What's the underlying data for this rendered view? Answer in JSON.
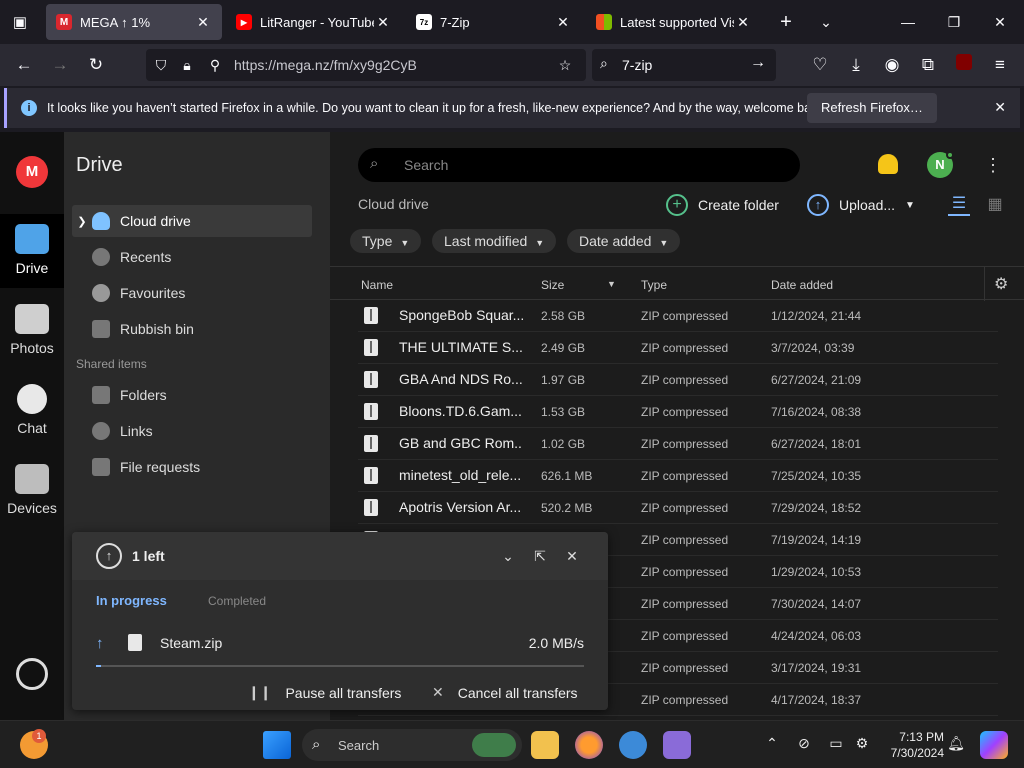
{
  "browser": {
    "tabs": [
      {
        "label": "MEGA ↑ 1%",
        "active": true,
        "favicon_color": "#d9272e",
        "favicon_text": "M"
      },
      {
        "label": "LitRanger - YouTube",
        "active": false,
        "favicon_color": "#ff0000",
        "favicon_text": "▶"
      },
      {
        "label": "7-Zip",
        "active": false,
        "favicon_color": "#ffffff",
        "favicon_text": "7z"
      },
      {
        "label": "Latest supported Visual",
        "active": false,
        "favicon_color": "#f25022",
        "favicon_text": ""
      }
    ],
    "url": "https://mega.nz/fm/xy9g2CyB",
    "search_value": "7-zip",
    "notification": {
      "message": "It looks like you haven’t started Firefox in a while. Do you want to clean it up for a fresh, like-new experience? And by the way, welcome back!",
      "button": "Refresh Firefox…"
    }
  },
  "rail": {
    "logo": "M",
    "items": [
      {
        "label": "Drive",
        "active": true
      },
      {
        "label": "Photos",
        "active": false
      },
      {
        "label": "Chat",
        "active": false
      },
      {
        "label": "Devices",
        "active": false
      }
    ]
  },
  "sidebar": {
    "title": "Drive",
    "items": [
      {
        "label": "Cloud drive",
        "active": true
      },
      {
        "label": "Recents"
      },
      {
        "label": "Favourites"
      },
      {
        "label": "Rubbish bin"
      }
    ],
    "shared_label": "Shared items",
    "shared_items": [
      {
        "label": "Folders"
      },
      {
        "label": "Links"
      },
      {
        "label": "File requests"
      }
    ]
  },
  "main": {
    "search_placeholder": "Search",
    "avatar_initial": "N",
    "breadcrumb": "Cloud drive",
    "create_folder": "Create folder",
    "upload": "Upload...",
    "filters": [
      "Type",
      "Last modified",
      "Date added"
    ],
    "columns": {
      "name": "Name",
      "size": "Size",
      "type": "Type",
      "date": "Date added"
    },
    "rows": [
      {
        "name": "SpongeBob Squar...",
        "size": "2.58 GB",
        "type": "ZIP compressed",
        "date": "1/12/2024, 21:44"
      },
      {
        "name": "THE ULTIMATE S...",
        "size": "2.49 GB",
        "type": "ZIP compressed",
        "date": "3/7/2024, 03:39"
      },
      {
        "name": "GBA And NDS Ro...",
        "size": "1.97 GB",
        "type": "ZIP compressed",
        "date": "6/27/2024, 21:09"
      },
      {
        "name": "Bloons.TD.6.Gam...",
        "size": "1.53 GB",
        "type": "ZIP compressed",
        "date": "7/16/2024, 08:38"
      },
      {
        "name": "GB and GBC Rom...",
        "size": "1.02 GB",
        "type": "ZIP compressed",
        "date": "6/27/2024, 18:01"
      },
      {
        "name": "minetest_old_rele...",
        "size": "626.1 MB",
        "type": "ZIP compressed",
        "date": "7/25/2024, 10:35"
      },
      {
        "name": "Apotris Version Ar...",
        "size": "520.2 MB",
        "type": "ZIP compressed",
        "date": "7/29/2024, 18:52"
      },
      {
        "name": "",
        "size": "",
        "type": "ZIP compressed",
        "date": "7/19/2024, 14:19"
      },
      {
        "name": "",
        "size": "",
        "type": "ZIP compressed",
        "date": "1/29/2024, 10:53"
      },
      {
        "name": "",
        "size": "",
        "type": "ZIP compressed",
        "date": "7/30/2024, 14:07"
      },
      {
        "name": "",
        "size": "",
        "type": "ZIP compressed",
        "date": "4/24/2024, 06:03"
      },
      {
        "name": "",
        "size": "",
        "type": "ZIP compressed",
        "date": "3/17/2024, 19:31"
      },
      {
        "name": "",
        "size": "",
        "type": "ZIP compressed",
        "date": "4/17/2024, 18:37"
      }
    ]
  },
  "transfers": {
    "count_label": "1 left",
    "tab_in_progress": "In progress",
    "tab_completed": "Completed",
    "file_name": "Steam.zip",
    "speed": "2.0 MB/s",
    "progress": 0.01,
    "pause_all": "Pause all transfers",
    "cancel_all": "Cancel all transfers"
  },
  "taskbar": {
    "search_label": "Search",
    "notification_badge": "1",
    "time": "7:13 PM",
    "date": "7/30/2024"
  },
  "colors": {
    "accent_blue": "#7fb7ff",
    "mega_red": "#f0373a",
    "create_green": "#55c08b"
  }
}
